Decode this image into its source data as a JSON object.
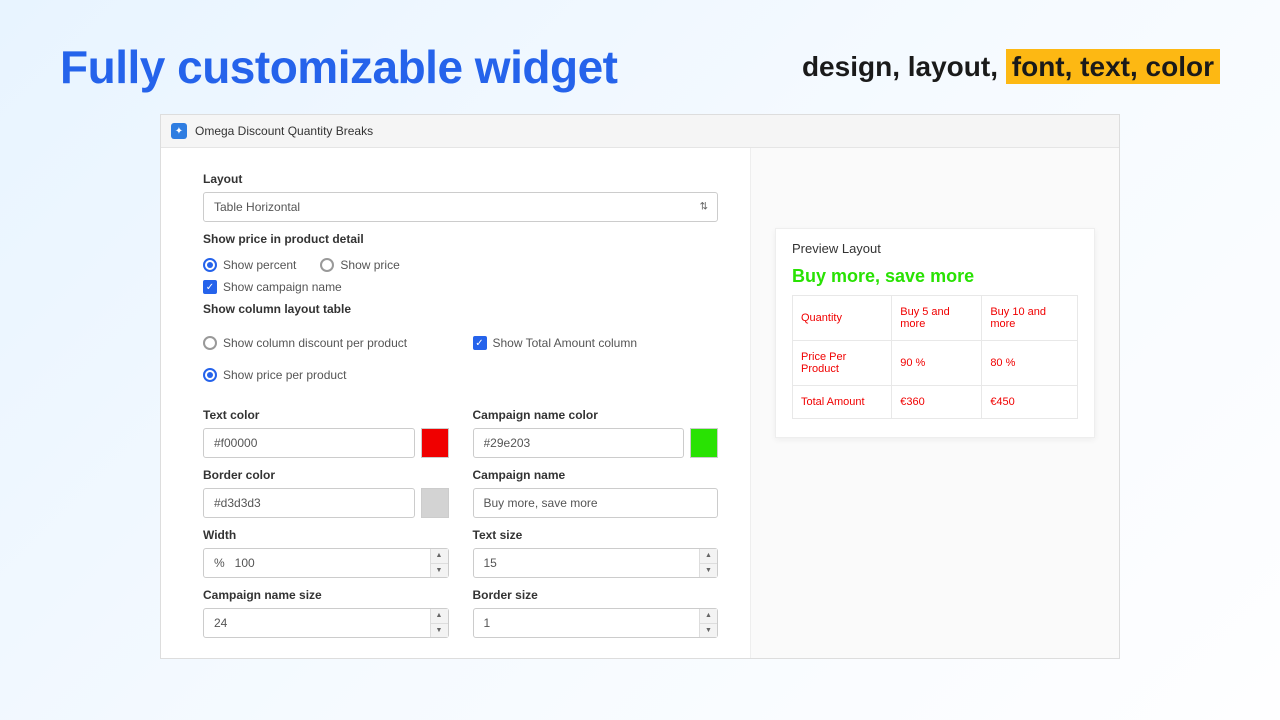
{
  "hero": {
    "title": "Fully customizable widget",
    "subtitle_plain": "design, layout, ",
    "subtitle_highlight": "font, text, color"
  },
  "app": {
    "title": "Omega Discount Quantity Breaks"
  },
  "form": {
    "layout_label": "Layout",
    "layout_value": "Table Horizontal",
    "show_price_label": "Show price in product detail",
    "radio_percent": "Show percent",
    "radio_price": "Show price",
    "check_campaign_name": "Show campaign name",
    "column_layout_label": "Show column layout table",
    "radio_col_discount": "Show column discount per product",
    "check_total_amount": "Show Total Amount column",
    "radio_price_per_product": "Show price per product",
    "text_color_label": "Text color",
    "text_color_value": "#f00000",
    "campaign_color_label": "Campaign name color",
    "campaign_color_value": "#29e203",
    "border_color_label": "Border color",
    "border_color_value": "#d3d3d3",
    "campaign_name_label": "Campaign name",
    "campaign_name_value": "Buy more, save more",
    "width_label": "Width",
    "width_value": "%   100",
    "text_size_label": "Text size",
    "text_size_value": "15",
    "campaign_size_label": "Campaign name size",
    "campaign_size_value": "24",
    "border_size_label": "Border size",
    "border_size_value": "1"
  },
  "preview": {
    "title": "Preview Layout",
    "campaign": "Buy more, save more",
    "row_qty_label": "Quantity",
    "row_price_label": "Price Per Product",
    "row_total_label": "Total Amount",
    "col1_header": "Buy 5 and more",
    "col2_header": "Buy 10 and more",
    "col1_price": "90 %",
    "col2_price": "80 %",
    "col1_total": "€360",
    "col2_total": "€450"
  },
  "colors": {
    "text_swatch": "#f00000",
    "campaign_swatch": "#29e203",
    "border_swatch": "#d3d3d3"
  }
}
